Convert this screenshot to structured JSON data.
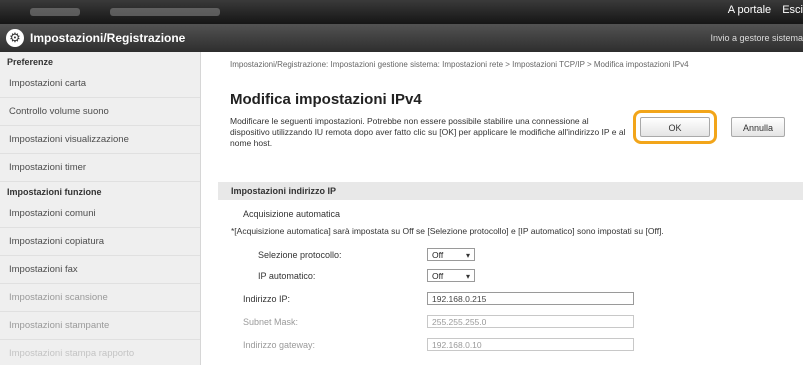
{
  "topbar": {
    "links": [
      "A portale",
      "Esci"
    ]
  },
  "header": {
    "title": "Impostazioni/Registrazione",
    "portal_link": "Invio a gestore sistema"
  },
  "sidebar": {
    "section_preferences": "Preferenze",
    "preferences_items": [
      "Impostazioni carta",
      "Controllo volume suono",
      "Impostazioni visualizzazione",
      "Impostazioni timer"
    ],
    "section_functions": "Impostazioni funzione",
    "function_items": [
      "Impostazioni comuni",
      "Impostazioni copiatura",
      "Impostazioni fax",
      "Impostazioni scansione",
      "Impostazioni stampante",
      "Impostazioni stampa rapporto"
    ]
  },
  "main": {
    "breadcrumb": "Impostazioni/Registrazione: Impostazioni gestione sistema: Impostazioni rete > Impostazioni TCP/IP > Modifica impostazioni IPv4",
    "title": "Modifica impostazioni IPv4",
    "description": "Modificare le seguenti impostazioni. Potrebbe non essere possibile stabilire una connessione al dispositivo utilizzando IU remota dopo aver fatto clic su [OK] per applicare le modifiche all'indirizzo IP e al nome host.",
    "ok_label": "OK",
    "cancel_label": "Annulla",
    "section_ip": "Impostazioni indirizzo IP",
    "auto_acquire": "Acquisizione automatica",
    "note": "*[Acquisizione automatica] sarà impostata su Off se [Selezione protocollo] e [IP automatico] sono impostati su [Off].",
    "protocol_label": "Selezione protocollo:",
    "protocol_value": "Off",
    "auto_ip_label": "IP automatico:",
    "auto_ip_value": "Off",
    "ip_label": "Indirizzo IP:",
    "ip_value": "192.168.0.215",
    "subnet_label": "Subnet Mask:",
    "subnet_value": "255.255.255.0",
    "gateway_label": "Indirizzo gateway:",
    "gateway_value": "192.168.0.10"
  },
  "colors": {
    "highlight": "#f2a51a",
    "header_bg": "#3a3a3a",
    "sidebar_bg": "#efefef"
  }
}
